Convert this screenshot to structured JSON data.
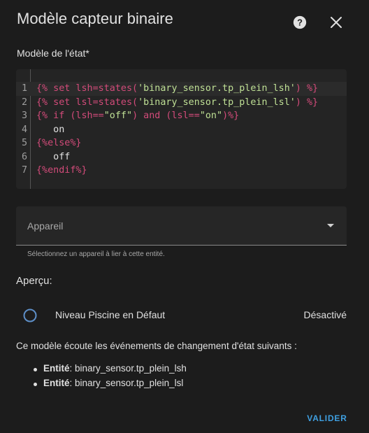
{
  "dialog": {
    "title": "Modèle capteur binaire",
    "help_icon": "help-circle-icon",
    "close_icon": "close-icon"
  },
  "state_template": {
    "label": "Modèle de l'état*",
    "lines": [
      {
        "n": "1",
        "tokens": [
          {
            "t": "{%",
            "c": "kw"
          },
          {
            "t": " set lsh=states(",
            "c": "kw"
          },
          {
            "t": "'binary_sensor.tp_plein_lsh'",
            "c": "str"
          },
          {
            "t": ") %}",
            "c": "kw"
          }
        ]
      },
      {
        "n": "2",
        "tokens": [
          {
            "t": "{%",
            "c": "kw"
          },
          {
            "t": " set lsl=states(",
            "c": "kw"
          },
          {
            "t": "'binary_sensor.tp_plein_lsl'",
            "c": "str"
          },
          {
            "t": ") %}",
            "c": "kw"
          }
        ]
      },
      {
        "n": "3",
        "tokens": [
          {
            "t": "{%",
            "c": "kw"
          },
          {
            "t": " if (lsh==",
            "c": "kw"
          },
          {
            "t": "\"off\"",
            "c": "str"
          },
          {
            "t": ") and (lsl==",
            "c": "kw"
          },
          {
            "t": "\"on\"",
            "c": "str"
          },
          {
            "t": ")%}",
            "c": "kw"
          }
        ]
      },
      {
        "n": "4",
        "tokens": [
          {
            "t": "   on",
            "c": "plain"
          }
        ]
      },
      {
        "n": "5",
        "tokens": [
          {
            "t": "{%else%}",
            "c": "kw"
          }
        ]
      },
      {
        "n": "6",
        "tokens": [
          {
            "t": "   off",
            "c": "plain"
          }
        ]
      },
      {
        "n": "7",
        "tokens": [
          {
            "t": "{%endif%}",
            "c": "kw"
          }
        ]
      }
    ]
  },
  "device_select": {
    "label": "Appareil",
    "helper": "Sélectionnez un appareil à lier à cette entité.",
    "arrow_icon": "dropdown-arrow-icon"
  },
  "preview": {
    "heading": "Aperçu:",
    "entity_name": "Niveau Piscine en Défaut",
    "entity_state": "Désactivé",
    "icon": "radio-circle-icon"
  },
  "listeners": {
    "intro": "Ce modèle écoute les événements de changement d'état suivants :",
    "items": [
      {
        "prefix": "Entité",
        "value": ": binary_sensor.tp_plein_lsh"
      },
      {
        "prefix": "Entité",
        "value": ": binary_sensor.tp_plein_lsl"
      }
    ]
  },
  "actions": {
    "submit_label": "VALIDER"
  },
  "colors": {
    "background": "#1c1c1c",
    "accent": "#3f9fe0",
    "code_keyword": "#d34b7a",
    "code_string": "#bfe095"
  }
}
